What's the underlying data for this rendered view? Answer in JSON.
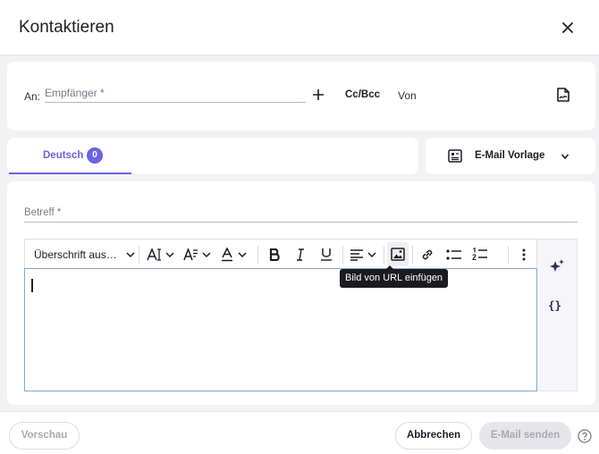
{
  "dialog": {
    "title": "Kontaktieren"
  },
  "recipients": {
    "to_label": "An:",
    "to_placeholder": "Empfänger *",
    "cc_bcc": "Cc/Bcc",
    "from_label": "Von"
  },
  "language_tabs": [
    {
      "label": "Deutsch",
      "count": "0",
      "active": true
    }
  ],
  "template": {
    "label": "E-Mail Vorlage"
  },
  "subject": {
    "placeholder": "Betreff *"
  },
  "toolbar": {
    "heading_select": "Überschrift aus…",
    "items": [
      "font-size",
      "text-style",
      "font-color",
      "bold",
      "italic",
      "underline",
      "align",
      "insert-image-from-url",
      "link",
      "bulleted-list",
      "numbered-list",
      "more"
    ],
    "tooltip": "Bild von URL einfügen"
  },
  "side_panel": {
    "braces": "{}"
  },
  "footer": {
    "preview": "Vorschau",
    "cancel": "Abbrechen",
    "send": "E-Mail senden"
  },
  "colors": {
    "accent": "#6c63e0",
    "focus_border": "#7fa7de"
  }
}
